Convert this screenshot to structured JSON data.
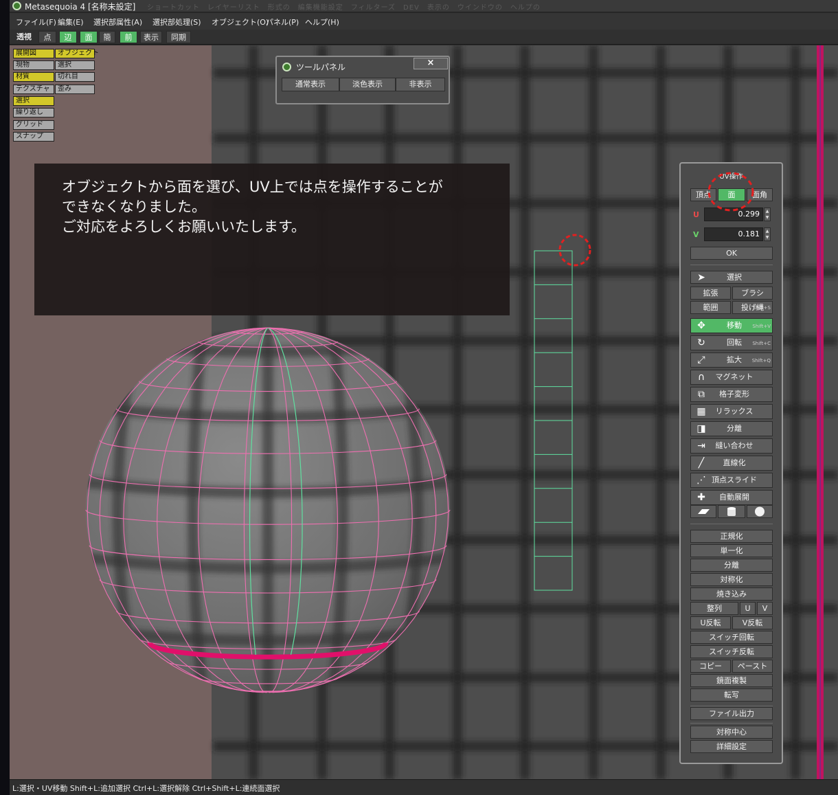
{
  "window": {
    "title": "Metasequoia 4 [名称未設定]",
    "ghost_menus": "ショートカット　レイヤーリスト　形式の　編集機能設定　フィルターズ　DEV　表示の　ウインドウの　ヘルプの"
  },
  "menu": [
    "ファイル(F)",
    "編集(E)",
    "選択部属性(A)",
    "選択部処理(S)",
    "オブジェクト(O)",
    "パネル(P)",
    "ヘルプ(H)"
  ],
  "modebar": {
    "perspective": "透視",
    "point": "点",
    "edge": "辺",
    "face": "面",
    "simple": "簡",
    "front": "前",
    "display": "表示",
    "sync": "同期"
  },
  "display_panel": {
    "left": [
      "展開図",
      "現物",
      "材質",
      "テクスチャ",
      "選択",
      "繰り返し",
      "グリッド",
      "スナップ"
    ],
    "right": [
      "オブジェクト",
      "選択",
      "切れ目",
      "歪み"
    ]
  },
  "tool_panel": {
    "title": "ツールパネル",
    "close": "×",
    "buttons": [
      "通常表示",
      "淡色表示",
      "非表示"
    ]
  },
  "note": {
    "line1": "オブジェクトから面を選び、UV上では点を操作することが",
    "line2": "できなくなりました。",
    "line3": "ご対応をよろしくお願いいたします。"
  },
  "uv_panel": {
    "title": "UV操作",
    "mode": {
      "vertex": "頂点",
      "face": "面",
      "corner": "面角"
    },
    "u_label": "U",
    "v_label": "V",
    "u_value": "0.299",
    "v_value": "0.181",
    "ok": "OK",
    "select": "選択",
    "expand": "拡張",
    "brush": "ブラシ",
    "range": "範囲",
    "lasso": "投げ縄",
    "lasso_sc": "Shift+S",
    "tools": [
      {
        "label": "移動",
        "icon": "move-icon",
        "glyph": "✥",
        "shortcut": "Shift+V",
        "active": true
      },
      {
        "label": "回転",
        "icon": "rotate-icon",
        "glyph": "↻",
        "shortcut": "Shift+C",
        "active": false
      },
      {
        "label": "拡大",
        "icon": "scale-icon",
        "glyph": "⤢",
        "shortcut": "Shift+Q",
        "active": false
      },
      {
        "label": "マグネット",
        "icon": "magnet-icon",
        "glyph": "∩",
        "shortcut": "",
        "active": false
      },
      {
        "label": "格子変形",
        "icon": "lattice-icon",
        "glyph": "⧉",
        "shortcut": "",
        "active": false
      },
      {
        "label": "リラックス",
        "icon": "relax-icon",
        "glyph": "▦",
        "shortcut": "",
        "active": false
      },
      {
        "label": "分離",
        "icon": "separate-icon",
        "glyph": "◨",
        "shortcut": "",
        "active": false
      },
      {
        "label": "縫い合わせ",
        "icon": "stitch-icon",
        "glyph": "⇥",
        "shortcut": "",
        "active": false
      },
      {
        "label": "直線化",
        "icon": "straighten-icon",
        "glyph": "╱",
        "shortcut": "",
        "active": false
      },
      {
        "label": "頂点スライド",
        "icon": "vertex-slide-icon",
        "glyph": "⋰",
        "shortcut": "",
        "active": false
      },
      {
        "label": "自動展開",
        "icon": "auto-unwrap-icon",
        "glyph": "✚",
        "shortcut": "",
        "active": false
      }
    ],
    "projection": [
      "plane-projection-icon",
      "cylinder-projection-icon",
      "sphere-projection-icon"
    ],
    "ops": {
      "normalize": "正規化",
      "unify": "単一化",
      "split": "分離",
      "symmetrize": "対称化",
      "bake": "焼き込み",
      "align": "整列",
      "align_u": "U",
      "align_v": "V",
      "flip_u": "U反転",
      "flip_v": "V反転",
      "swap_rotate": "スイッチ回転",
      "swap_flip": "スイッチ反転",
      "copy": "コピー",
      "paste": "ペースト",
      "mirror_dup": "鏡面複製",
      "transfer": "転写",
      "export": "ファイル出力",
      "sym_center": "対称中心",
      "detail": "詳細設定"
    }
  },
  "status": "L:選択・UV移動  Shift+L:追加選択  Ctrl+L:選択解除  Ctrl+Shift+L:連続面選択",
  "colors": {
    "active_green": "#52b866",
    "wire_pink": "#ee6fb0",
    "seam_magenta": "#e0106a",
    "uv_green": "#5fe0a0",
    "annotation_red": "#e32020"
  }
}
